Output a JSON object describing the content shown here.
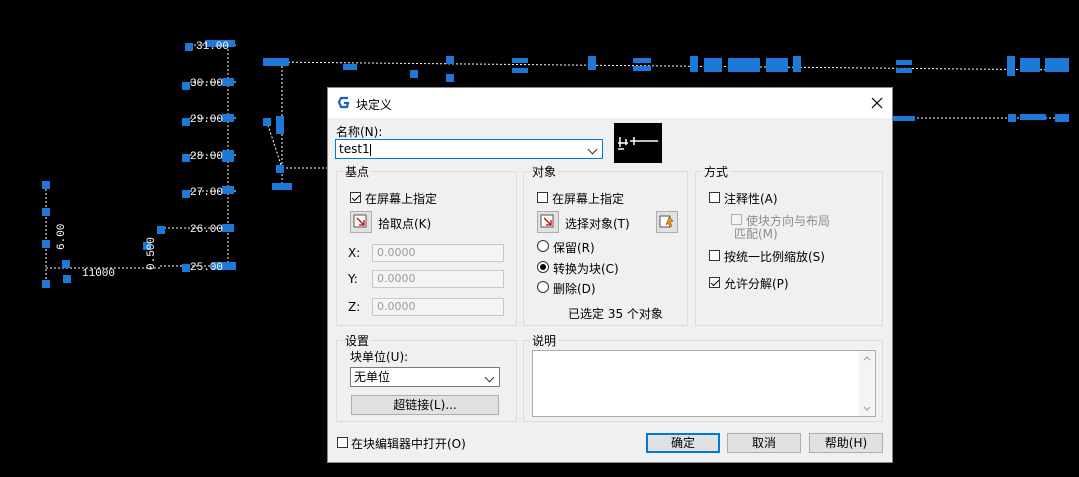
{
  "dialog": {
    "title": "块定义",
    "name_label": "名称(N):",
    "name_value": "test1",
    "basepoint": {
      "title": "基点",
      "on_screen": "在屏幕上指定",
      "on_screen_checked": true,
      "pick_point": "拾取点(K)",
      "x_label": "X:",
      "x_value": "0.0000",
      "y_label": "Y:",
      "y_value": "0.0000",
      "z_label": "Z:",
      "z_value": "0.0000"
    },
    "objects": {
      "title": "对象",
      "on_screen": "在屏幕上指定",
      "on_screen_checked": false,
      "select_objects": "选择对象(T)",
      "retain": "保留(R)",
      "convert": "转换为块(C)",
      "delete": "删除(D)",
      "selected_count": "已选定 35 个对象"
    },
    "behavior": {
      "title": "方式",
      "annotative": "注释性(A)",
      "match_orientation": "使块方向与布局",
      "match_orientation_2": "匹配(M)",
      "scale_uniformly": "按统一比例缩放(S)",
      "allow_explode": "允许分解(P)",
      "allow_explode_checked": true
    },
    "settings": {
      "title": "设置",
      "block_unit_label": "块单位(U):",
      "block_unit_value": "无单位",
      "hyperlink": "超链接(L)..."
    },
    "description": {
      "title": "说明"
    },
    "open_in_editor": "在块编辑器中打开(O)",
    "ok": "确定",
    "cancel": "取消",
    "help": "帮助(H)"
  },
  "cad_labels": {
    "l1": "31.00",
    "l2": "30.00",
    "l3": "29.00",
    "l4": "28.00",
    "l5": "27.00",
    "l6": "26.00",
    "l7": "25.00",
    "l8": "0.500",
    "l9": "6.00",
    "l10": "11000"
  },
  "colors": {
    "grip": "#1e78d7",
    "accent": "#0078d7"
  }
}
